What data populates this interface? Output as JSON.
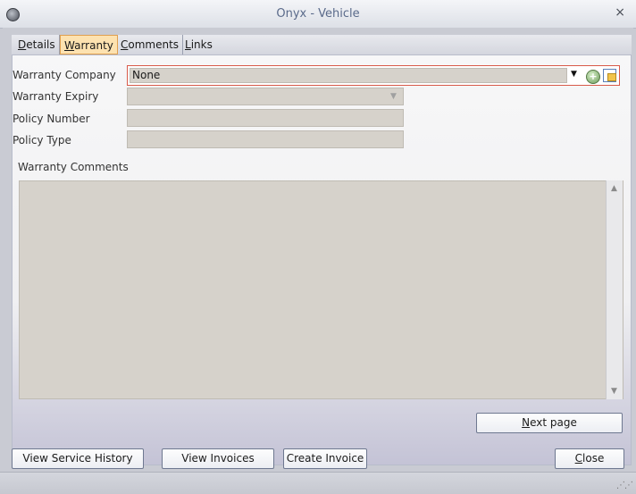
{
  "window": {
    "title": "Onyx - Vehicle",
    "close_glyph": "×"
  },
  "tabs": [
    {
      "label": "Details",
      "mnemonic": "D",
      "rest": "etails"
    },
    {
      "label": "Warranty",
      "mnemonic": "W",
      "rest": "arranty"
    },
    {
      "label": "Comments",
      "mnemonic": "C",
      "rest": "omments"
    },
    {
      "label": "Links",
      "mnemonic": "L",
      "rest": "inks"
    }
  ],
  "form": {
    "warranty_company_label": "Warranty Company",
    "warranty_company_value": "None",
    "warranty_expiry_label": "Warranty Expiry",
    "warranty_expiry_value": "",
    "policy_number_label": "Policy Number",
    "policy_number_value": "",
    "policy_type_label": "Policy Type",
    "policy_type_value": "",
    "warranty_comments_label": "Warranty Comments",
    "warranty_comments_value": ""
  },
  "buttons": {
    "next_page": {
      "mnemonic": "N",
      "rest": "ext page"
    },
    "view_service_history": "View Service History",
    "view_invoices": "View Invoices",
    "create_invoice": "Create Invoice",
    "close": {
      "mnemonic": "C",
      "rest": "lose"
    }
  },
  "icons": {
    "app": "app-icon",
    "close": "close-icon",
    "dropdown": "chevron-down-icon",
    "add": "add-icon",
    "lookup": "lookup-icon",
    "scroll_up": "scroll-up-icon",
    "scroll_down": "scroll-down-icon",
    "resize": "resize-grip-icon"
  },
  "colors": {
    "active_tab": "#fde2b0",
    "focus_border": "#d85a4a",
    "title_text": "#5a6a8a"
  }
}
